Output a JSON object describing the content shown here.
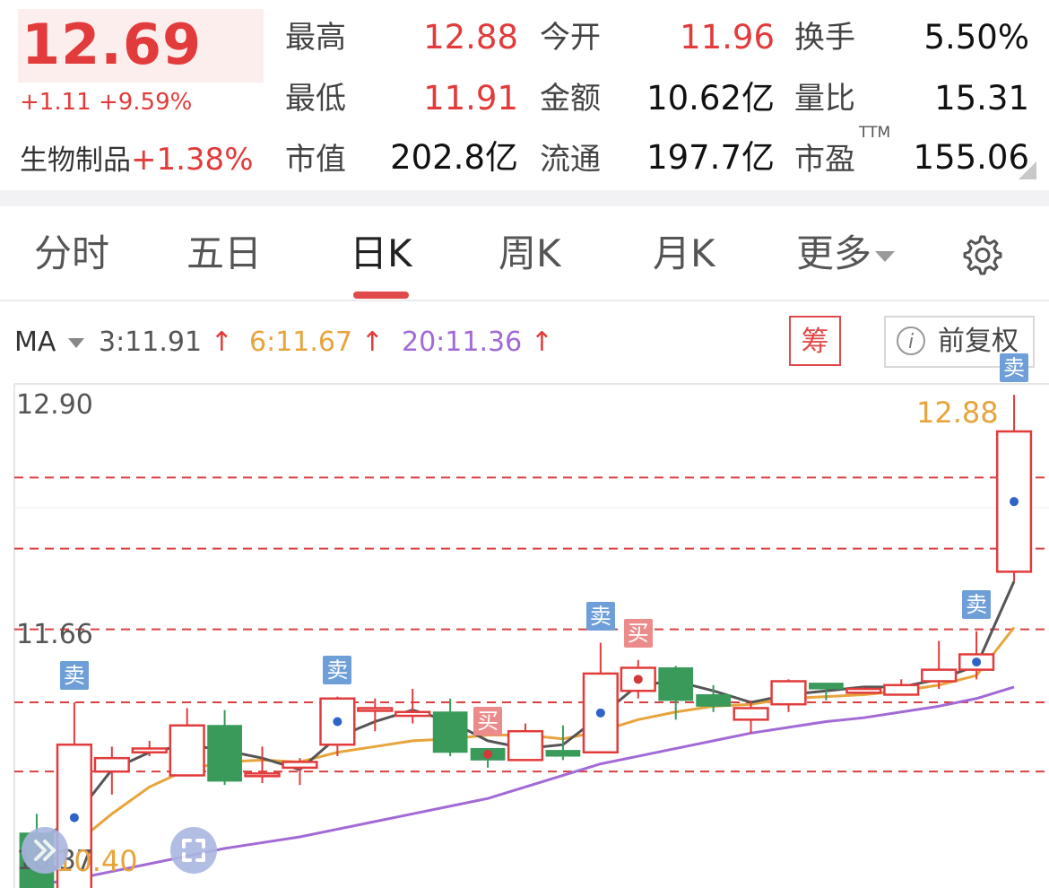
{
  "quote": {
    "price": "12.69",
    "change": "+1.11",
    "change_pct": "+9.59%",
    "sector_name": "生物制品",
    "sector_change": "+1.38%",
    "stats": [
      {
        "label": "最高",
        "value": "12.88",
        "color": "red"
      },
      {
        "label": "今开",
        "value": "11.96",
        "color": "red"
      },
      {
        "label": "换手",
        "value": "5.50%",
        "color": "black"
      },
      {
        "label": "最低",
        "value": "11.91",
        "color": "red"
      },
      {
        "label": "金额",
        "value": "10.62亿",
        "color": "black"
      },
      {
        "label": "量比",
        "value": "15.31",
        "color": "black"
      },
      {
        "label": "市值",
        "value": "202.8亿",
        "color": "black"
      },
      {
        "label": "流通",
        "value": "197.7亿",
        "color": "black"
      },
      {
        "label": "市盈",
        "value": "155.06",
        "color": "black"
      }
    ],
    "pe_superscript": "TTM"
  },
  "tabs": [
    {
      "label": "分时",
      "active": false
    },
    {
      "label": "五日",
      "active": false
    },
    {
      "label": "日K",
      "active": true
    },
    {
      "label": "周K",
      "active": false
    },
    {
      "label": "月K",
      "active": false
    },
    {
      "label": "更多",
      "active": false
    }
  ],
  "ma": {
    "label": "MA",
    "items": [
      {
        "text": "3:11.91",
        "arrow": "↑",
        "color": "#555555"
      },
      {
        "text": "6:11.67",
        "arrow": "↑",
        "color": "#e8a43c"
      },
      {
        "text": "20:11.36",
        "arrow": "↑",
        "color": "#a26ad6"
      }
    ],
    "chip_label": "筹",
    "adjust_label": "前复权",
    "info_glyph": "i"
  },
  "axis": {
    "top": "12.90",
    "mid": "11.66",
    "bottom": "10.37",
    "low_marker": "10.40",
    "high_marker": "12.88"
  },
  "colors": {
    "up": "#e23b3b",
    "down": "#3a9a5a",
    "ma3": "#555555",
    "ma6": "#e8a43c",
    "ma20": "#a26ad6",
    "dash": "#d94040"
  },
  "tags": {
    "sell": "卖",
    "buy": "买"
  },
  "chart_data": {
    "type": "candlestick",
    "price_range": [
      10.37,
      12.9
    ],
    "reference_levels": [
      12.45,
      12.08,
      11.66,
      11.28,
      10.92
    ],
    "candles": [
      {
        "o": 10.6,
        "c": 10.25,
        "h": 10.7,
        "l": 10.2
      },
      {
        "o": 10.3,
        "c": 11.06,
        "h": 11.28,
        "l": 10.3
      },
      {
        "o": 10.92,
        "c": 10.99,
        "h": 11.05,
        "l": 10.8
      },
      {
        "o": 11.02,
        "c": 11.04,
        "h": 11.08,
        "l": 11.0
      },
      {
        "o": 10.9,
        "c": 11.16,
        "h": 11.25,
        "l": 10.9
      },
      {
        "o": 11.16,
        "c": 10.87,
        "h": 11.24,
        "l": 10.85
      },
      {
        "o": 10.9,
        "c": 10.91,
        "h": 11.05,
        "l": 10.86
      },
      {
        "o": 10.94,
        "c": 10.97,
        "h": 10.99,
        "l": 10.85
      },
      {
        "o": 11.06,
        "c": 11.3,
        "h": 11.31,
        "l": 11.0
      },
      {
        "o": 11.24,
        "c": 11.25,
        "h": 11.3,
        "l": 11.13
      },
      {
        "o": 11.21,
        "c": 11.23,
        "h": 11.35,
        "l": 11.17
      },
      {
        "o": 11.23,
        "c": 11.02,
        "h": 11.3,
        "l": 11.0
      },
      {
        "o": 11.04,
        "c": 10.98,
        "h": 11.04,
        "l": 10.94
      },
      {
        "o": 10.98,
        "c": 11.13,
        "h": 11.17,
        "l": 10.98
      },
      {
        "o": 11.03,
        "c": 11.0,
        "h": 11.16,
        "l": 10.98
      },
      {
        "o": 11.02,
        "c": 11.43,
        "h": 11.59,
        "l": 11.02
      },
      {
        "o": 11.34,
        "c": 11.46,
        "h": 11.5,
        "l": 11.3
      },
      {
        "o": 11.46,
        "c": 11.29,
        "h": 11.47,
        "l": 11.19
      },
      {
        "o": 11.32,
        "c": 11.26,
        "h": 11.37,
        "l": 11.23
      },
      {
        "o": 11.19,
        "c": 11.25,
        "h": 11.29,
        "l": 11.12
      },
      {
        "o": 11.27,
        "c": 11.39,
        "h": 11.4,
        "l": 11.23
      },
      {
        "o": 11.38,
        "c": 11.35,
        "h": 11.37,
        "l": 11.29
      },
      {
        "o": 11.33,
        "c": 11.35,
        "h": 11.36,
        "l": 11.33
      },
      {
        "o": 11.32,
        "c": 11.37,
        "h": 11.4,
        "l": 11.32
      },
      {
        "o": 11.39,
        "c": 11.45,
        "h": 11.6,
        "l": 11.35
      },
      {
        "o": 11.45,
        "c": 11.53,
        "h": 11.65,
        "l": 11.4
      },
      {
        "o": 11.96,
        "c": 12.69,
        "h": 12.88,
        "l": 11.91
      }
    ],
    "ma3": [
      10.55,
      10.68,
      10.93,
      11.02,
      11.06,
      11.03,
      10.99,
      10.93,
      11.1,
      11.18,
      11.24,
      11.18,
      11.08,
      11.04,
      11.06,
      11.21,
      11.37,
      11.39,
      11.34,
      11.28,
      11.32,
      11.34,
      11.36,
      11.36,
      11.4,
      11.47,
      11.91
    ],
    "ma6": [
      10.4,
      10.54,
      10.7,
      10.84,
      10.93,
      10.97,
      10.98,
      10.97,
      11.02,
      11.05,
      11.08,
      11.09,
      11.11,
      11.11,
      11.09,
      11.13,
      11.19,
      11.23,
      11.26,
      11.27,
      11.3,
      11.31,
      11.32,
      11.34,
      11.37,
      11.42,
      11.67
    ],
    "ma20": [
      10.33,
      10.36,
      10.4,
      10.44,
      10.48,
      10.52,
      10.55,
      10.58,
      10.62,
      10.66,
      10.7,
      10.74,
      10.78,
      10.84,
      10.9,
      10.96,
      11.0,
      11.04,
      11.08,
      11.12,
      11.15,
      11.18,
      11.2,
      11.23,
      11.26,
      11.3,
      11.36
    ],
    "buy_sell_marks": [
      {
        "index": 1,
        "type": "sell"
      },
      {
        "index": 8,
        "type": "sell"
      },
      {
        "index": 12,
        "type": "buy"
      },
      {
        "index": 15,
        "type": "sell"
      },
      {
        "index": 16,
        "type": "buy"
      },
      {
        "index": 25,
        "type": "sell"
      },
      {
        "index": 26,
        "type": "sell"
      }
    ]
  }
}
